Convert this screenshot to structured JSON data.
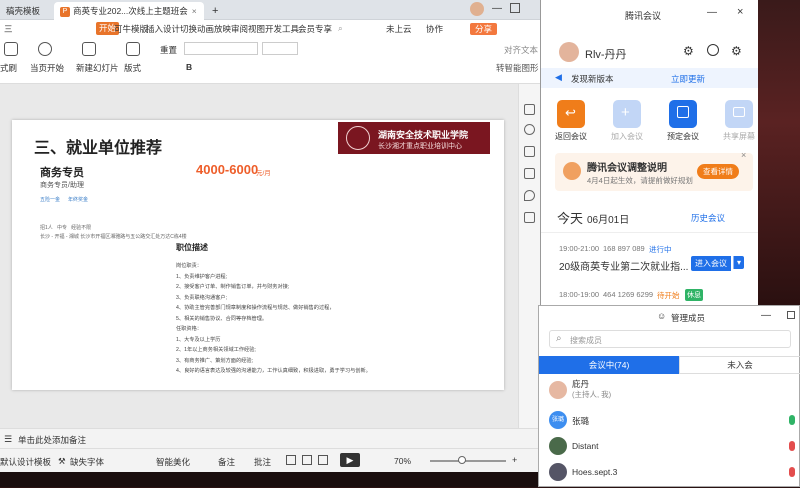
{
  "wps": {
    "tabs": [
      {
        "label": "稿壳模板"
      },
      {
        "label": "商英专业202...次线上主题班会"
      }
    ],
    "tab_add": "+",
    "menu": [
      "三",
      "文件",
      "开始",
      "可牛模版",
      "插入",
      "设计",
      "切换",
      "动画",
      "放映",
      "审阅",
      "视图",
      "开发工具",
      "会员专享"
    ],
    "top_right": {
      "cloud": "未上云",
      "collab": "协作",
      "share": "分享"
    },
    "ribbon": {
      "format_brush": "式刷",
      "play_from_current": "当页开始",
      "new_slide": "新建幻灯片",
      "layout": "版式",
      "reset": "重置",
      "font_B": "B",
      "align_text": "对齐文本",
      "convert_smartart": "转智能图形"
    },
    "slide": {
      "heading": "三、就业单位推荐",
      "banner_cn": "湖南安全技术职业学院",
      "banner_sub": "长沙湘才重点职业培训中心",
      "job_title": "商务专员",
      "job_sub": "商务专员/助理",
      "salary": "4000-6000",
      "salary_unit": "元/月",
      "tags": [
        "五险一金",
        "年终奖金"
      ],
      "meta": "招1人   中专   经验不限",
      "address": "长沙 - 开福 - 湘城   长沙市开福区湘雅路与五公路交汇处万达C栋4楼",
      "desc_title": "职位描述",
      "lines": [
        "岗位职责：",
        "1、负责维护客户进程;",
        "2、接受客户订单、制作销售订单，并与财务对接;",
        "3、负责联络沟通客户;",
        "4、协助主管完善部门规章制度和操作流程与规范、做好销售的过程，",
        "5、相关的销售协议、合同等存档管理。",
        "任职资格：",
        "1、大专及以上学历",
        "2、1年以上商务相关领域工作经验;",
        "3、有商务推广、策划方面的经验;",
        "4、良好的语言表达及较强的沟通能力，工作认真细致，积极进取，勇于学习与创新。"
      ]
    },
    "status": {
      "notes": "单击此处添加备注"
    },
    "bottom": {
      "design": "默认设计模板",
      "missing_font": "缺失字体",
      "beautify": "智能美化",
      "notes_btn": "备注",
      "comment_btn": "批注",
      "zoom": "70%"
    }
  },
  "meeting": {
    "title": "腾讯会议",
    "user_name": "Rlv-丹丹",
    "new_version": "发现新版本",
    "update_now": "立即更新",
    "actions": [
      {
        "label": "返回会议",
        "color": "#f07d1a"
      },
      {
        "label": "加入会议",
        "color": "#b9cff3"
      },
      {
        "label": "预定会议",
        "color": "#1f6fe8"
      },
      {
        "label": "共享屏幕",
        "color": "#b9cff3"
      }
    ],
    "notice_title": "腾讯会议调整说明",
    "notice_text": "4月4日起生效，请提前做好规划",
    "notice_btn": "查看详情",
    "today": "今天",
    "date": "06月01日",
    "history": "历史会议",
    "meetings": [
      {
        "time": "19:00-21:00",
        "id": "168 897 089",
        "status": "进行中",
        "status_color": "#1f6fe8",
        "title": "20级商英专业第二次就业指...",
        "btn": "进入会议"
      },
      {
        "time": "18:00-19:00",
        "id": "464 1269 6299",
        "status": "待开始",
        "status_color": "#f07d1a",
        "badge": "休息"
      }
    ]
  },
  "members": {
    "title": "管理成员",
    "search_placeholder": "搜索成员",
    "tab_in": "会议中(74)",
    "tab_out": "未入会",
    "list": [
      {
        "name": "庇丹",
        "sub": "(主持人, 我)",
        "avatar_text": "",
        "avatar_color": "#e6b8a2"
      },
      {
        "name": "张璐",
        "sub": "",
        "avatar_text": "张璐",
        "avatar_color": "#3d8ef0"
      },
      {
        "name": "Distant",
        "sub": "",
        "avatar_text": "",
        "avatar_color": "#4a6a4a"
      },
      {
        "name": "Hoes.sept.3",
        "sub": "",
        "avatar_text": "",
        "avatar_color": "#556"
      }
    ]
  }
}
